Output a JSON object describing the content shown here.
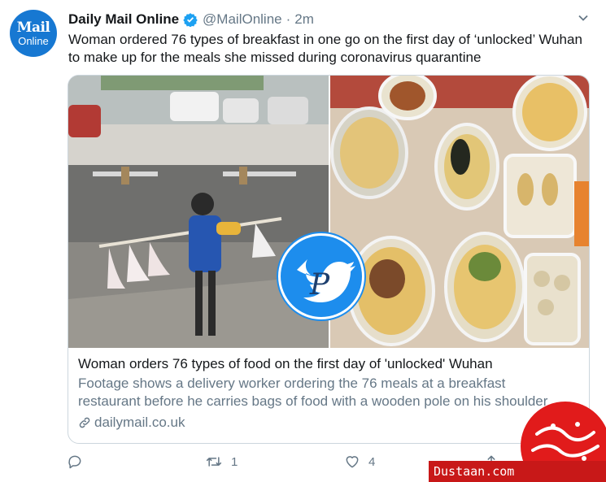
{
  "author": {
    "avatar_line1": "Mail",
    "avatar_line2": "Online",
    "name": "Daily Mail Online",
    "handle": "@MailOnline",
    "separator": "·",
    "time": "2m"
  },
  "tweet": {
    "text": "Woman ordered 76 types of breakfast in one go on the first day of ‘unlocked’ Wuhan to make up for the meals she missed during coronavirus quarantine"
  },
  "card": {
    "title": "Woman orders 76 types of food on the first day of 'unlocked' Wuhan",
    "description_line1": "Footage shows a delivery worker ordering the 76 meals at a breakfast",
    "description_line2": "restaurant before he carries bags of food with a wooden pole on his shoulder",
    "domain": "dailymail.co.uk"
  },
  "actions": {
    "reply_count": "",
    "retweet_count": "1",
    "like_count": "4"
  },
  "watermark": {
    "site": "Dustaan.com",
    "logo_letter": "P"
  },
  "colors": {
    "avatar": "#1778d2",
    "verified": "#1da1f2",
    "secondary_text": "#657786",
    "card_border": "#ccd6dd",
    "watermark_red": "#e11b1b"
  },
  "icons": [
    "verified-badge-icon",
    "chevron-down-icon",
    "link-icon",
    "reply-icon",
    "retweet-icon",
    "like-icon",
    "share-icon"
  ]
}
